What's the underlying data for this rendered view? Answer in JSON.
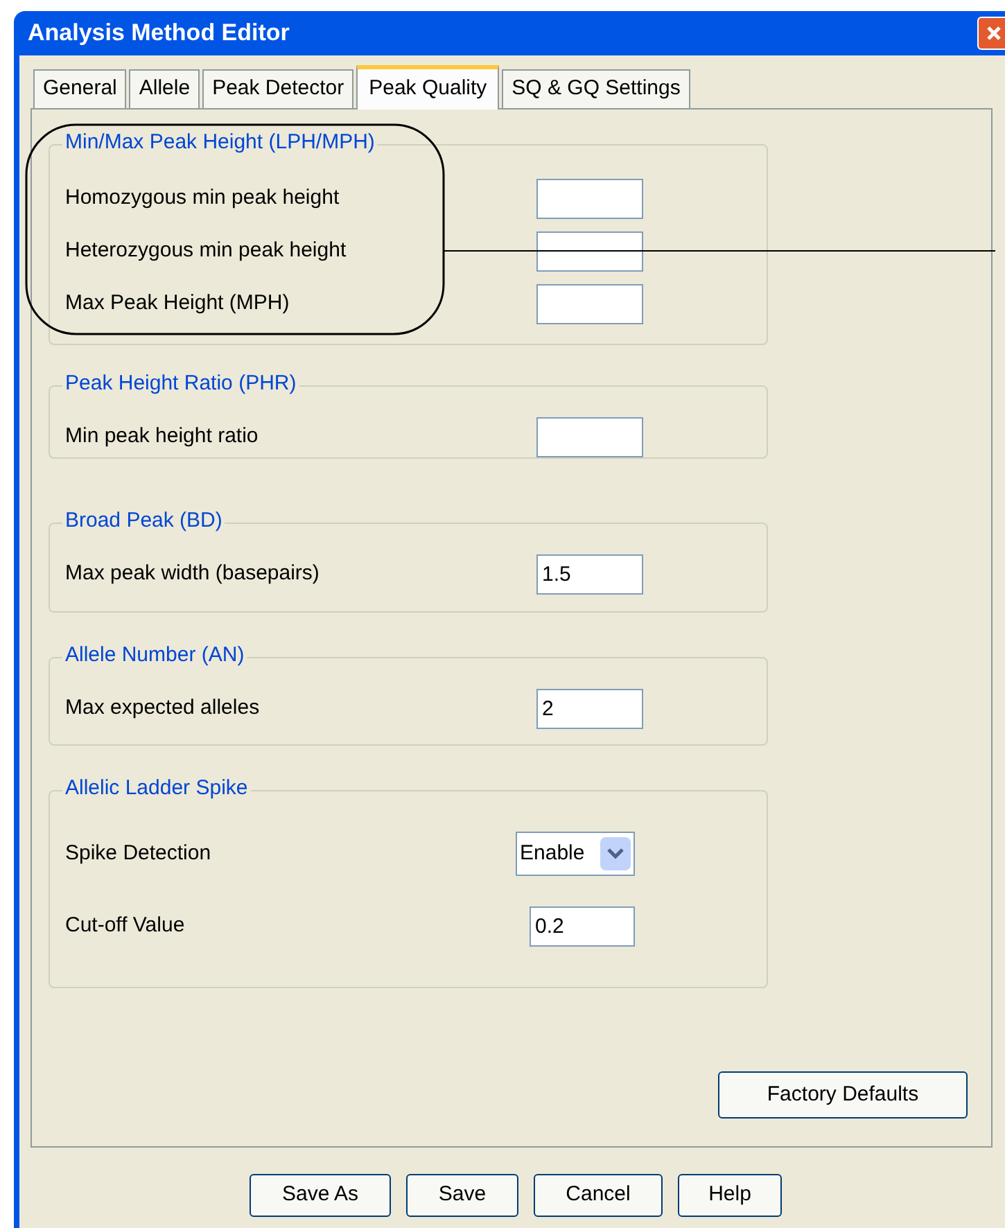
{
  "window": {
    "title": "Analysis Method Editor"
  },
  "tabs": [
    {
      "label": "General",
      "selected": false
    },
    {
      "label": "Allele",
      "selected": false
    },
    {
      "label": "Peak Detector",
      "selected": false
    },
    {
      "label": "Peak Quality",
      "selected": true
    },
    {
      "label": "SQ & GQ Settings",
      "selected": false
    }
  ],
  "groups": [
    {
      "title": "Min/Max Peak Height (LPH/MPH)",
      "highlighted": true,
      "rows": [
        {
          "kind": "text",
          "label": "Homozygous min peak height"
        },
        {
          "kind": "text",
          "label": "Heterozygous min peak height"
        },
        {
          "kind": "text",
          "label": "Max Peak Height (MPH)"
        }
      ]
    },
    {
      "title": "Peak Height Ratio (PHR)",
      "highlighted": false,
      "rows": [
        {
          "kind": "text",
          "label": "Min peak height ratio"
        }
      ]
    },
    {
      "title": "Broad Peak (BD)",
      "highlighted": false,
      "rows": [
        {
          "kind": "text",
          "label": "Max peak width (basepairs)",
          "value": "1.5"
        }
      ]
    },
    {
      "title": "Allele Number (AN)",
      "highlighted": false,
      "rows": [
        {
          "kind": "text",
          "label": "Max expected alleles",
          "value": "2"
        }
      ]
    },
    {
      "title": "Allelic Ladder Spike",
      "highlighted": false,
      "rows": [
        {
          "kind": "dropdown",
          "label": "Spike Detection",
          "value": "Enable"
        },
        {
          "kind": "text",
          "label": "Cut-off Value",
          "value": "0.2"
        }
      ]
    }
  ],
  "factory_button": "Factory Defaults",
  "buttons": [
    "Save As",
    "Save",
    "Cancel",
    "Help"
  ]
}
